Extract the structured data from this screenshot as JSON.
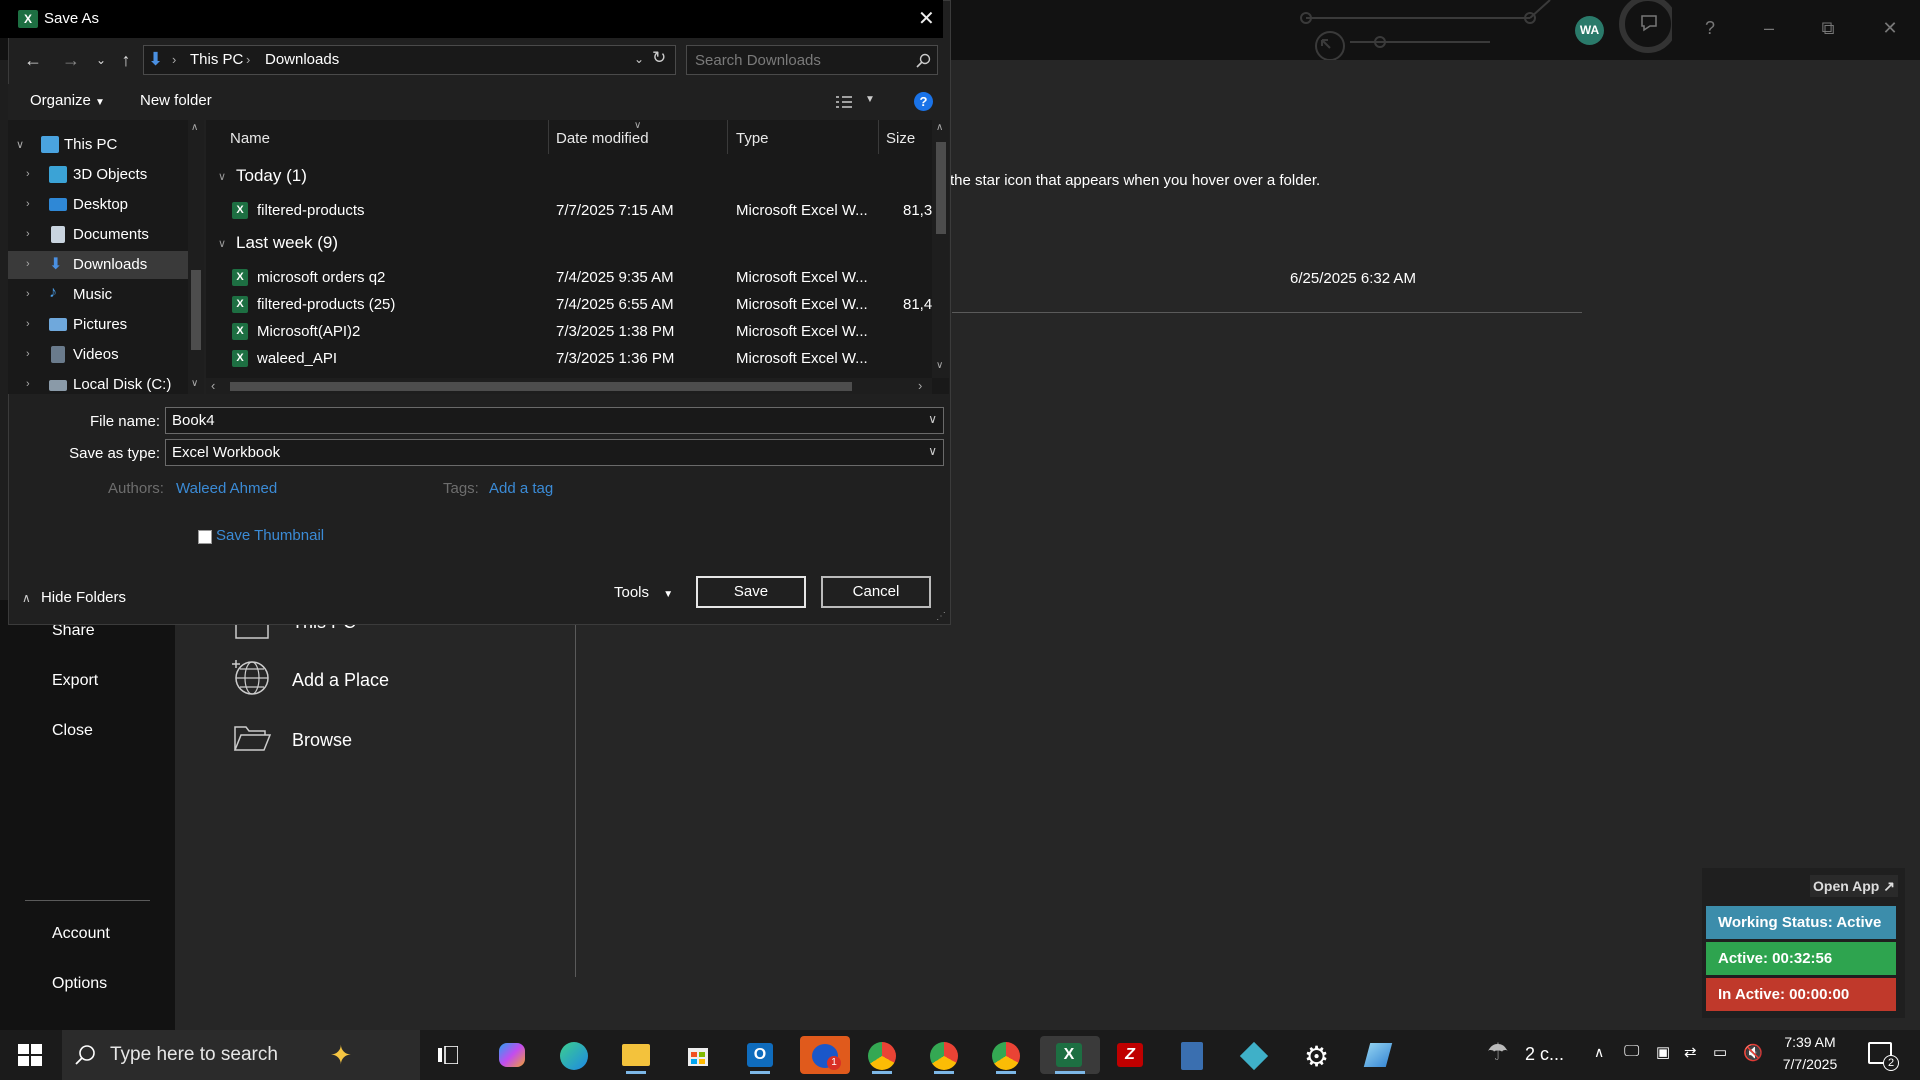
{
  "background": {
    "hint_text": "the star icon that appears when you hover over a folder.",
    "recent_date": "6/25/2025 6:32 AM",
    "avatar_initials": "WA",
    "left_menu": [
      {
        "label": "Share"
      },
      {
        "label": "Export"
      },
      {
        "label": "Close"
      },
      {
        "label": "Account"
      },
      {
        "label": "Options"
      }
    ],
    "places": [
      {
        "label": "This PC"
      },
      {
        "label": "Add a Place"
      },
      {
        "label": "Browse"
      }
    ]
  },
  "dialog": {
    "title": "Save As",
    "breadcrumb": [
      "This PC",
      "Downloads"
    ],
    "search_placeholder": "Search Downloads",
    "toolbar": {
      "organize": "Organize",
      "new_folder": "New folder"
    },
    "nav_tree": [
      {
        "label": "This PC",
        "expanded": true
      },
      {
        "label": "3D Objects"
      },
      {
        "label": "Desktop"
      },
      {
        "label": "Documents"
      },
      {
        "label": "Downloads",
        "selected": true
      },
      {
        "label": "Music"
      },
      {
        "label": "Pictures"
      },
      {
        "label": "Videos"
      },
      {
        "label": "Local Disk (C:)"
      }
    ],
    "columns": [
      "Name",
      "Date modified",
      "Type",
      "Size"
    ],
    "groups": [
      {
        "label": "Today (1)",
        "files": [
          {
            "name": "filtered-products",
            "date": "7/7/2025 7:15 AM",
            "type": "Microsoft Excel W...",
            "size": "81,3"
          }
        ]
      },
      {
        "label": "Last week (9)",
        "files": [
          {
            "name": "microsoft orders q2",
            "date": "7/4/2025 9:35 AM",
            "type": "Microsoft Excel W...",
            "size": ""
          },
          {
            "name": "filtered-products (25)",
            "date": "7/4/2025 6:55 AM",
            "type": "Microsoft Excel W...",
            "size": "81,4"
          },
          {
            "name": "Microsoft(API)2",
            "date": "7/3/2025 1:38 PM",
            "type": "Microsoft Excel W...",
            "size": ""
          },
          {
            "name": "waleed_API",
            "date": "7/3/2025 1:36 PM",
            "type": "Microsoft Excel W...",
            "size": ""
          }
        ]
      }
    ],
    "form": {
      "file_name_label": "File name:",
      "file_name_value": "Book4",
      "save_type_label": "Save as type:",
      "save_type_value": "Excel Workbook",
      "authors_label": "Authors:",
      "authors_value": "Waleed Ahmed",
      "tags_label": "Tags:",
      "tags_value": "Add a tag",
      "thumbnail_label": "Save Thumbnail"
    },
    "footer": {
      "hide_folders": "Hide Folders",
      "tools": "Tools",
      "save": "Save",
      "cancel": "Cancel"
    }
  },
  "status_widget": {
    "open_app": "Open App ↗",
    "working_status": "Working Status: Active",
    "active_time": "Active: 00:32:56",
    "inactive_time": "In Active: 00:00:00",
    "colors": {
      "working": "#3c8dab",
      "active": "#2ea44f",
      "inactive": "#c0392b"
    }
  },
  "taskbar": {
    "search_placeholder": "Type here to search",
    "weather": "2 c...",
    "time": "7:39 AM",
    "date": "7/7/2025",
    "notification_count": "2",
    "calendar_badge": "1"
  }
}
